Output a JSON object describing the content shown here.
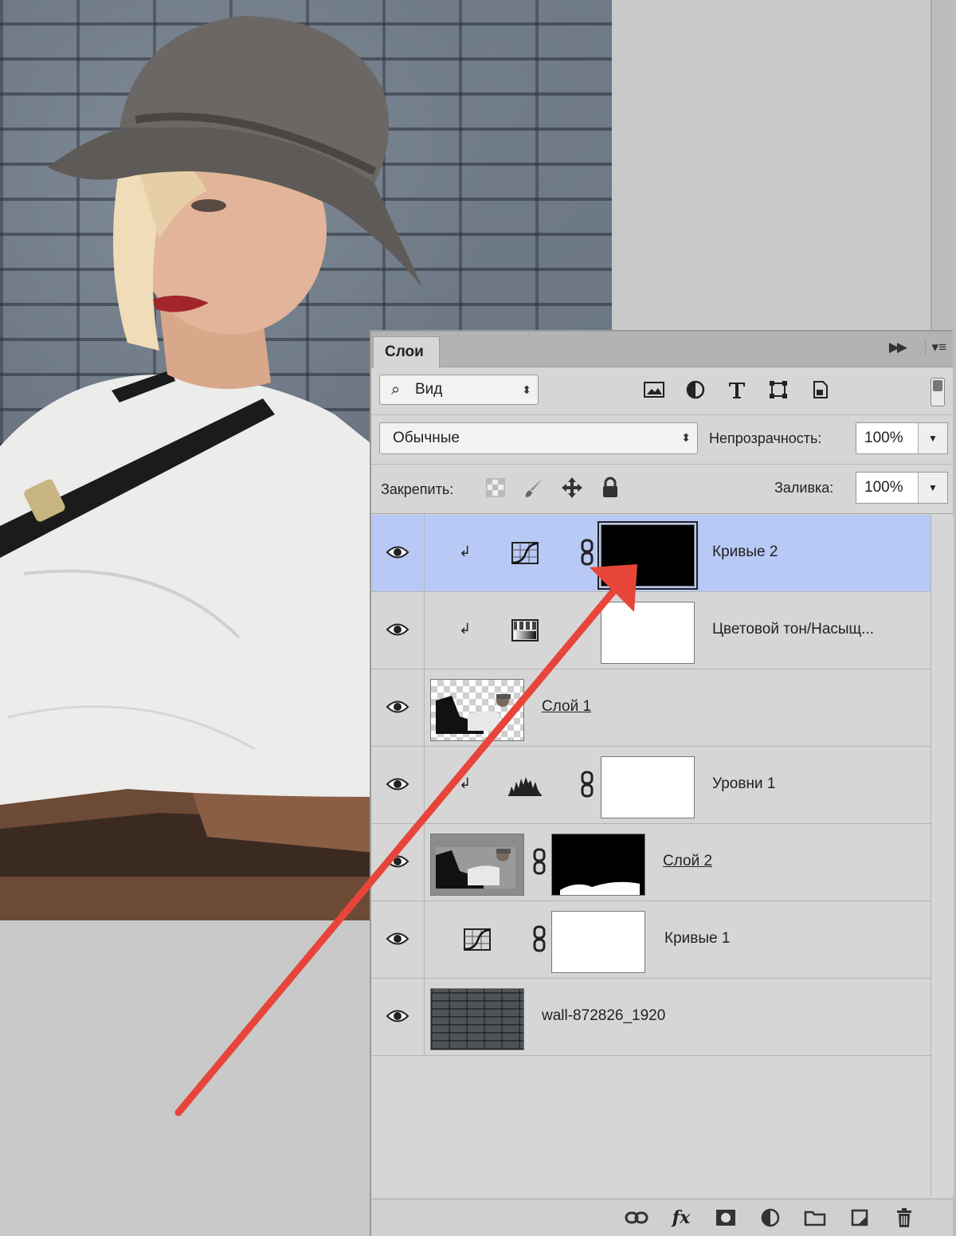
{
  "panel": {
    "tab_label": "Слои",
    "filter": {
      "label": "Вид"
    },
    "filter_icons": [
      "image-filter-icon",
      "adjustment-filter-icon",
      "type-filter-icon",
      "shape-filter-icon",
      "smart-object-filter-icon"
    ],
    "blend_mode": "Обычные",
    "opacity_label": "Непрозрачность:",
    "opacity_value": "100%",
    "lock_label": "Закрепить:",
    "lock_icons": [
      "lock-transparent-icon",
      "lock-brush-icon",
      "lock-move-icon",
      "lock-all-icon"
    ],
    "fill_label": "Заливка:",
    "fill_value": "100%",
    "layers": [
      {
        "name": "Кривые 2",
        "type": "curves-adjustment",
        "clipped": true,
        "mask": "black",
        "selected": true,
        "visible": true
      },
      {
        "name": "Цветовой тон/Насыщ...",
        "type": "hue-saturation-adjustment",
        "clipped": true,
        "mask": "white",
        "selected": false,
        "visible": true
      },
      {
        "name": "Слой 1",
        "type": "pixel",
        "thumb": "transparent-photo",
        "selected": false,
        "visible": true
      },
      {
        "name": "Уровни 1",
        "type": "levels-adjustment",
        "clipped": true,
        "mask": "white",
        "selected": false,
        "visible": true
      },
      {
        "name": "Слой 2",
        "type": "pixel",
        "thumb": "photo",
        "mask": "black-with-white",
        "selected": false,
        "visible": true
      },
      {
        "name": "Кривые 1",
        "type": "curves-adjustment",
        "clipped": false,
        "mask": "white",
        "selected": false,
        "visible": true
      },
      {
        "name": "wall-872826_1920",
        "type": "pixel",
        "thumb": "wall",
        "selected": false,
        "visible": true
      }
    ],
    "bottom_icons": [
      "link-layers-icon",
      "fx-icon",
      "add-mask-icon",
      "new-adjustment-icon",
      "new-group-icon",
      "new-layer-icon",
      "delete-layer-icon"
    ]
  },
  "colors": {
    "selected_row": "#b9c9f5",
    "panel_bg": "#d6d6d6",
    "annotation_arrow": "#e8453a"
  }
}
